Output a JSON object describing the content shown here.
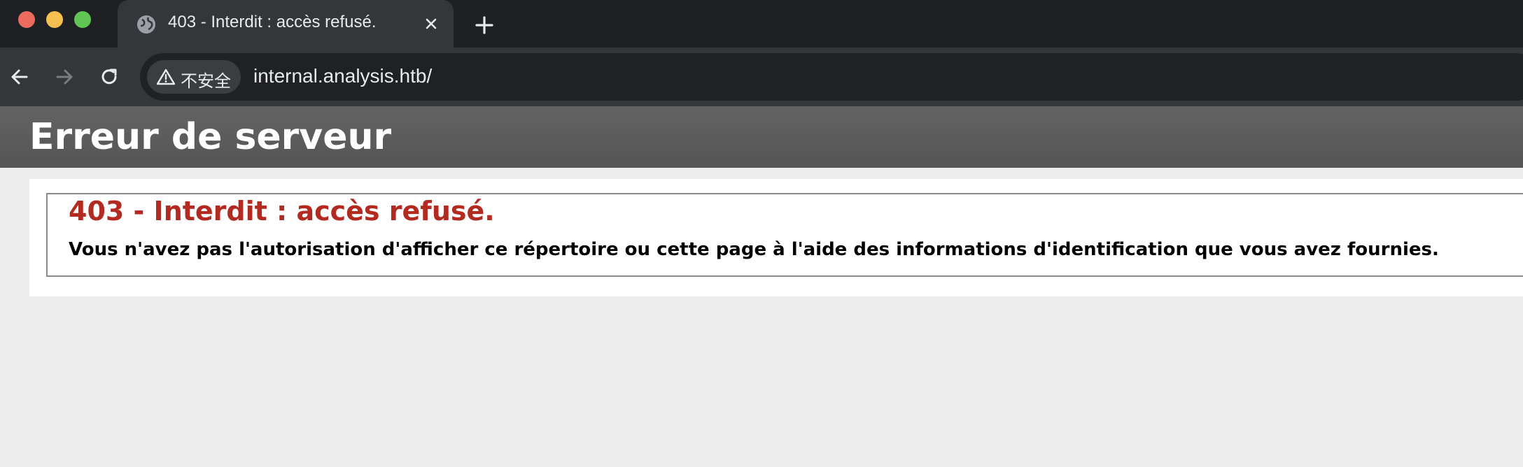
{
  "browser": {
    "tab": {
      "title": "403 - Interdit : accès refusé.",
      "icon": "globe-icon"
    },
    "toolbar": {
      "security_label": "不安全",
      "url": "internal.analysis.htb/"
    },
    "colors": {
      "tabstrip": "#1f2023",
      "toolbar": "#35363a",
      "omnibox": "#202124"
    }
  },
  "page": {
    "header_title": "Erreur de serveur",
    "error_title": "403 - Interdit : accès refusé.",
    "error_message": "Vous n'avez pas l'autorisation d'afficher ce répertoire ou cette page à l'aide des informations d'identification que vous avez fournies.",
    "colors": {
      "error_title": "#b22a20",
      "header_bg": "#5a5a5a"
    }
  }
}
